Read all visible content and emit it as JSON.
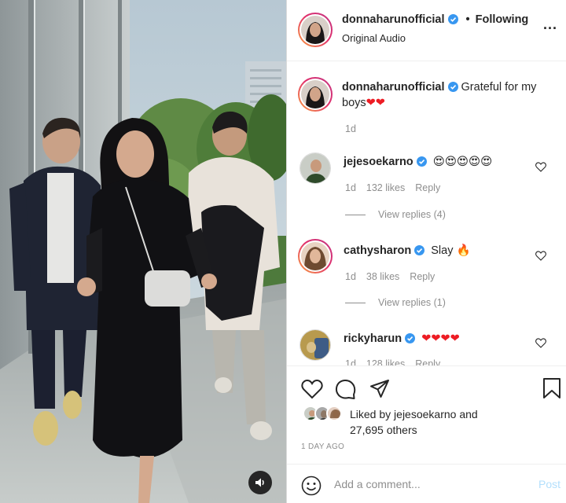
{
  "media": {
    "audio_icon": "speaker-icon"
  },
  "header": {
    "username": "donnaharunofficial",
    "separator": "•",
    "follow_status": "Following",
    "audio_label": "Original Audio",
    "more_icon": "more-icon",
    "more_label": "..."
  },
  "caption": {
    "username": "donnaharunofficial",
    "text": "Grateful for my boys",
    "emoji": "❤❤",
    "age": "1d"
  },
  "comments": [
    {
      "username": "jejesoekarno",
      "text": "😍😍😍😍😍",
      "age": "1d",
      "likes": "132 likes",
      "reply": "Reply",
      "view_replies": "View replies (4)"
    },
    {
      "username": "cathysharon",
      "text": "Slay 🔥",
      "age": "1d",
      "likes": "38 likes",
      "reply": "Reply",
      "view_replies": "View replies (1)"
    },
    {
      "username": "rickyharun",
      "text": "❤❤❤❤",
      "age": "1d",
      "likes": "128 likes",
      "reply": "Reply"
    }
  ],
  "actions": {
    "like_icon": "heart-icon",
    "comment_icon": "comment-icon",
    "share_icon": "paper-plane-icon",
    "save_icon": "bookmark-icon",
    "liked_by_prefix": "Liked by",
    "liked_by_user": "jejesoekarno",
    "liked_by_and": "and",
    "others": "27,695 others",
    "time_ago": "1 DAY AGO"
  },
  "add_comment": {
    "emoji_icon": "smiley-icon",
    "placeholder": "Add a comment...",
    "post_label": "Post"
  },
  "colors": {
    "verified": "#3897f0",
    "heart": "#ed1c24",
    "post_disabled": "#b2dffc",
    "muted": "#8e8e8e"
  }
}
